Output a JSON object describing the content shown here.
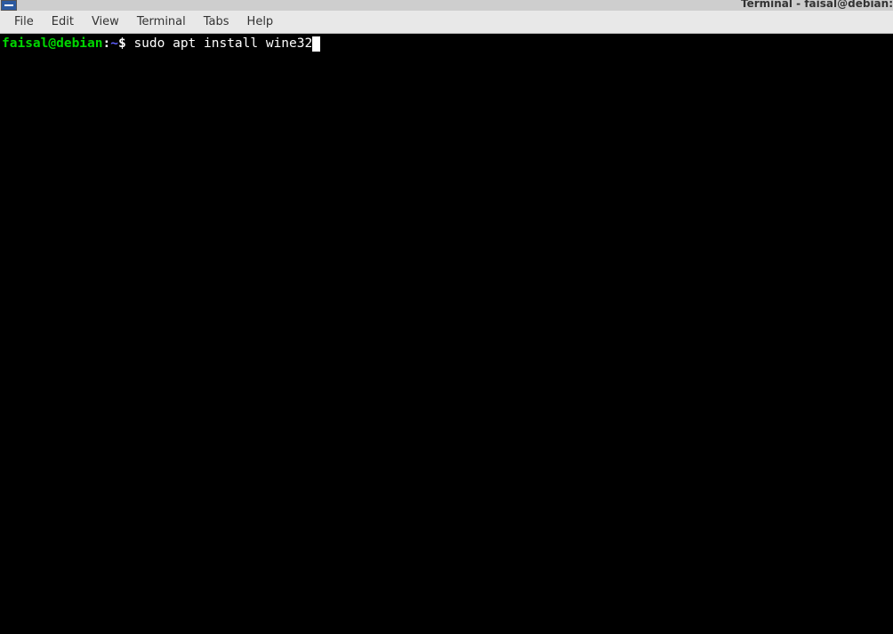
{
  "window": {
    "title": "Terminal - faisal@debian:"
  },
  "menubar": {
    "items": [
      "File",
      "Edit",
      "View",
      "Terminal",
      "Tabs",
      "Help"
    ]
  },
  "terminal": {
    "prompt_user": "faisal@debian",
    "prompt_colon": ":",
    "prompt_path": "~",
    "prompt_symbol": "$ ",
    "command": "sudo apt install wine32"
  }
}
